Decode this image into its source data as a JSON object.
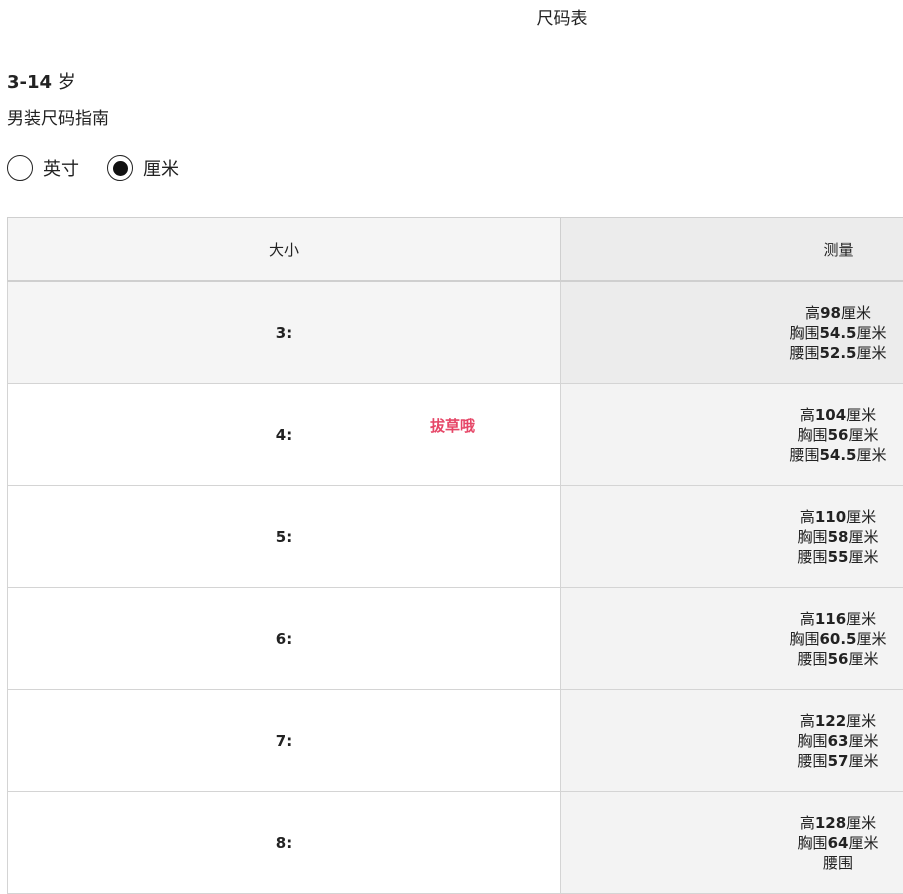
{
  "page_title": "尺码表",
  "age_range": {
    "number": "3-14",
    "unit": "岁"
  },
  "subtitle": "男装尺码指南",
  "unit_toggle": {
    "options": [
      {
        "label": "英寸",
        "selected": false
      },
      {
        "label": "厘米",
        "selected": true
      }
    ]
  },
  "table": {
    "headers": {
      "size": "大小",
      "measurement": "测量"
    },
    "rows": [
      {
        "size": "3:",
        "height": {
          "label": "高",
          "value": "98",
          "unit": "厘米"
        },
        "chest": {
          "label": "胸围",
          "value": "54.5",
          "unit": "厘米"
        },
        "waist": {
          "label": "腰围",
          "value": "52.5",
          "unit": "厘米"
        }
      },
      {
        "size": "4:",
        "height": {
          "label": "高",
          "value": "104",
          "unit": "厘米"
        },
        "chest": {
          "label": "胸围",
          "value": "56",
          "unit": "厘米"
        },
        "waist": {
          "label": "腰围",
          "value": "54.5",
          "unit": "厘米"
        }
      },
      {
        "size": "5:",
        "height": {
          "label": "高",
          "value": "110",
          "unit": "厘米"
        },
        "chest": {
          "label": "胸围",
          "value": "58",
          "unit": "厘米"
        },
        "waist": {
          "label": "腰围",
          "value": "55",
          "unit": "厘米"
        }
      },
      {
        "size": "6:",
        "height": {
          "label": "高",
          "value": "116",
          "unit": "厘米"
        },
        "chest": {
          "label": "胸围",
          "value": "60.5",
          "unit": "厘米"
        },
        "waist": {
          "label": "腰围",
          "value": "56",
          "unit": "厘米"
        }
      },
      {
        "size": "7:",
        "height": {
          "label": "高",
          "value": "122",
          "unit": "厘米"
        },
        "chest": {
          "label": "胸围",
          "value": "63",
          "unit": "厘米"
        },
        "waist": {
          "label": "腰围",
          "value": "57",
          "unit": "厘米"
        }
      },
      {
        "size": "8:",
        "height": {
          "label": "高",
          "value": "128",
          "unit": "厘米"
        },
        "chest": {
          "label": "胸围",
          "value": "64",
          "unit": "厘米"
        },
        "waist": {
          "label": "腰围",
          "value": "",
          "unit": ""
        }
      }
    ]
  },
  "watermark": {
    "text": "拔草哦",
    "color": "#e64667"
  }
}
